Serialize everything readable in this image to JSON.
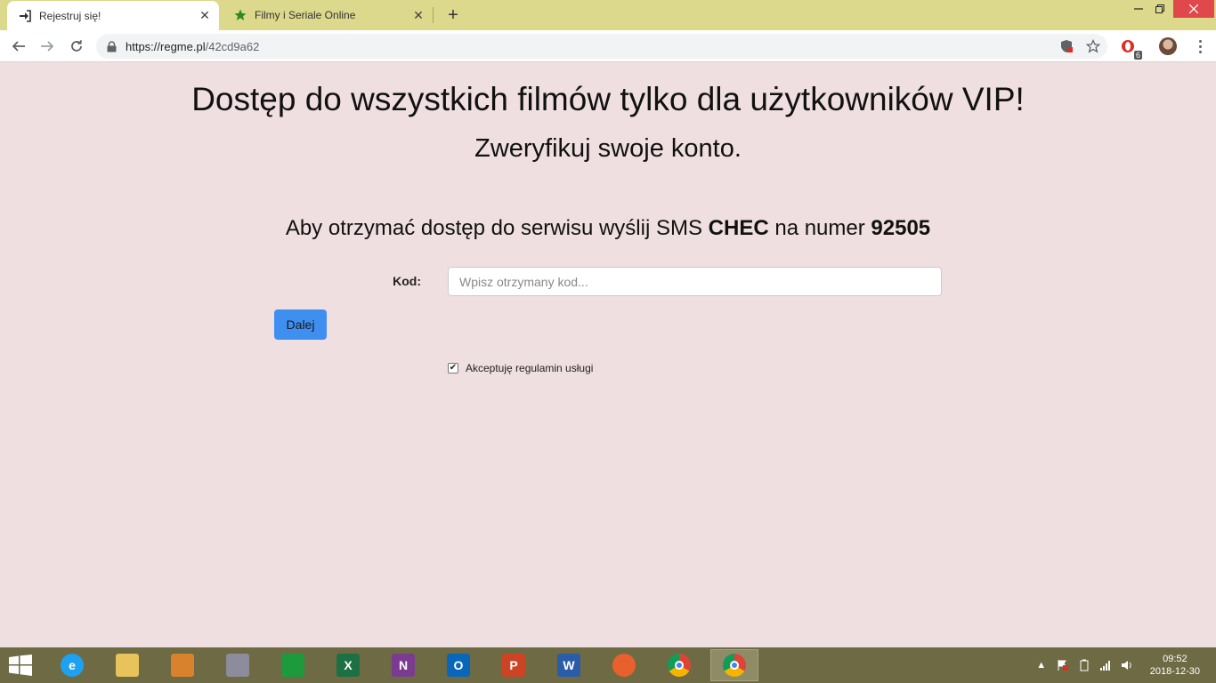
{
  "browser": {
    "tabs": [
      {
        "title": "Rejestruj się!",
        "icon": "sign-in-icon",
        "active": true
      },
      {
        "title": "Filmy i Seriale Online",
        "icon": "star-icon",
        "active": false
      }
    ],
    "new_tab_label": "+",
    "url_main": "https://regme.pl",
    "url_path": "/42cd9a62",
    "extension_badge": "6"
  },
  "page": {
    "heading": "Dostęp do wszystkich filmów tylko dla użytkowników VIP!",
    "subheading": "Zweryfikuj swoje konto.",
    "instruction_prefix": "Aby otrzymać dostęp do serwisu wyślij SMS ",
    "sms_code": "CHEC",
    "instruction_middle": " na numer ",
    "sms_number": "92505",
    "code_label": "Kod:",
    "code_placeholder": "Wpisz otrzymany kod...",
    "code_value": "",
    "submit_label": "Dalej",
    "terms_label": "Akceptuję regulamin usługi",
    "terms_checked": true
  },
  "taskbar": {
    "apps": [
      {
        "name": "internet-explorer-icon",
        "letter": "e",
        "color": "#1ea1f1"
      },
      {
        "name": "file-explorer-icon",
        "letter": "",
        "color": "#e8c25a"
      },
      {
        "name": "photo-viewer-icon",
        "letter": "",
        "color": "#d8822e"
      },
      {
        "name": "media-player-icon",
        "letter": "",
        "color": "#8c8c9c"
      },
      {
        "name": "store-icon",
        "letter": "",
        "color": "#1d9b3c"
      },
      {
        "name": "excel-icon",
        "letter": "X",
        "color": "#1d7044"
      },
      {
        "name": "onenote-icon",
        "letter": "N",
        "color": "#7b3b91"
      },
      {
        "name": "outlook-icon",
        "letter": "O",
        "color": "#0a66b8"
      },
      {
        "name": "powerpoint-icon",
        "letter": "P",
        "color": "#cc4424"
      },
      {
        "name": "word-icon",
        "letter": "W",
        "color": "#2b5ca8"
      },
      {
        "name": "firefox-icon",
        "letter": "",
        "color": "#e8612c"
      },
      {
        "name": "chrome-icon",
        "letter": "",
        "color": "#4285f4"
      },
      {
        "name": "chrome-active-icon",
        "letter": "",
        "color": "#4285f4"
      }
    ],
    "time": "09:52",
    "date": "2018-12-30"
  },
  "colors": {
    "page_background": "#f0dfe0",
    "tabstrip": "#dcd88c",
    "button": "#3e8ff0",
    "taskbar": "#6e6a44"
  }
}
